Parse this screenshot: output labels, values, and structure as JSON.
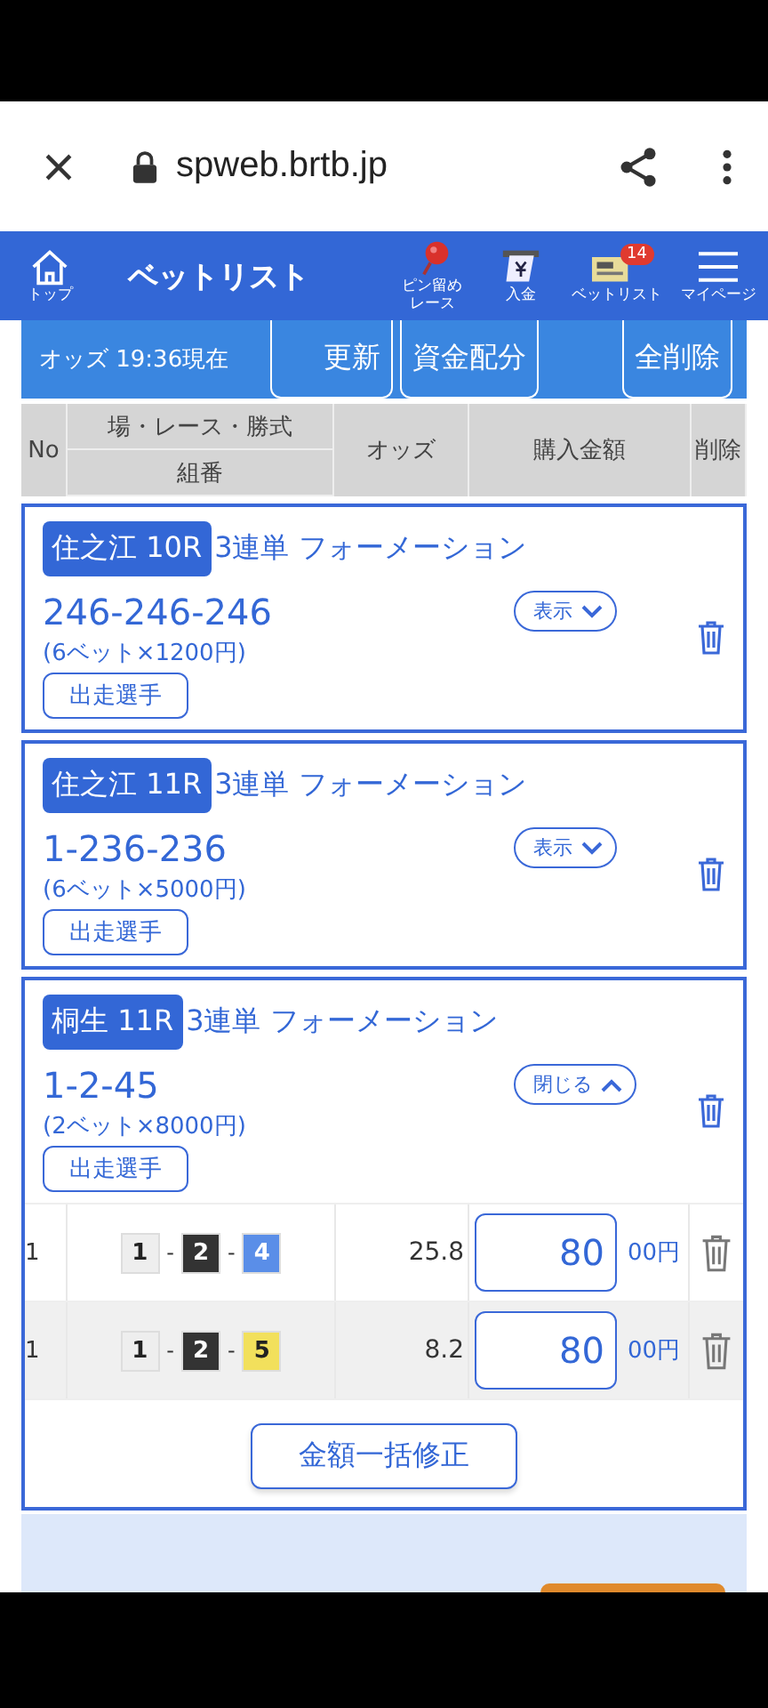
{
  "browser": {
    "url": "spweb.brtb.jp"
  },
  "header": {
    "title": "ベットリスト",
    "nav": [
      {
        "kind": "home",
        "label": "トップ"
      },
      {
        "kind": "pin",
        "label_lines": [
          "ピン留め",
          "レース"
        ]
      },
      {
        "kind": "deposit",
        "label": "入金"
      },
      {
        "kind": "betlist",
        "label": "ベットリスト",
        "badge": "14"
      },
      {
        "kind": "menu",
        "label": "マイページ"
      }
    ]
  },
  "toolbar": {
    "odds_time": "オッズ 19:36現在",
    "buttons": [
      "更新",
      "資金配分",
      "全削除"
    ]
  },
  "table": {
    "columns": [
      "No",
      "場・レース・勝式",
      "組番",
      "オッズ",
      "購入金額",
      "削除"
    ]
  },
  "bets": [
    {
      "venue": "住之江 10R",
      "bet_type": "3連単 フォーメーション",
      "combo": "246-246-246",
      "detail": "(6ベット×1200円)",
      "toggle": "表示",
      "expanded": false,
      "players_button": "出走選手"
    },
    {
      "venue": "住之江 11R",
      "bet_type": "3連単 フォーメーション",
      "combo": "1-236-236",
      "detail": "(6ベット×5000円)",
      "toggle": "表示",
      "expanded": false,
      "players_button": "出走選手"
    },
    {
      "venue": "桐生 11R",
      "bet_type": "3連単 フォーメーション",
      "combo": "1-2-45",
      "detail": "(2ベット×8000円)",
      "toggle": "閉じる",
      "expanded": true,
      "players_button": "出走選手",
      "bulk_button": "金額一括修正",
      "rows": [
        {
          "no": "1",
          "separator": "-",
          "boats": [
            {
              "number": "1",
              "color": "#eeeeee"
            },
            {
              "number": "2",
              "color": "#333333"
            },
            {
              "number": "4",
              "color": "#5a8ee8"
            }
          ],
          "odds": "25.8",
          "amount": "80",
          "unit": "00円"
        },
        {
          "no": "1",
          "separator": "-",
          "boats": [
            {
              "number": "1",
              "color": "#eeeeee"
            },
            {
              "number": "2",
              "color": "#333333"
            },
            {
              "number": "5",
              "color": "#f2e05c"
            }
          ],
          "odds": "8.2",
          "amount": "80",
          "unit": "00円"
        }
      ]
    }
  ]
}
